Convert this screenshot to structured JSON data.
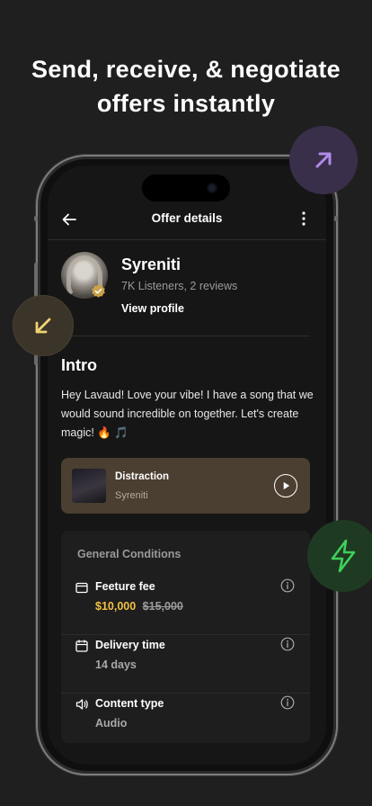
{
  "headline": {
    "line1": "Send, receive, & negotiate",
    "line2": "offers instantly"
  },
  "nav": {
    "title": "Offer details",
    "back_icon": "arrow-left-icon",
    "more_icon": "more-vertical-icon"
  },
  "profile": {
    "name": "Syreniti",
    "stats": "7K Listeners, 2 reviews",
    "view_profile": "View profile",
    "verified_icon": "verified-badge-icon"
  },
  "intro": {
    "title": "Intro",
    "text": "Hey Lavaud! Love your vibe! I have a song that we would sound incredible on together. Let's create magic! 🔥 🎵"
  },
  "track": {
    "title": "Distraction",
    "artist": "Syreniti",
    "play_icon": "play-icon"
  },
  "conditions": {
    "heading": "General Conditions",
    "rows": [
      {
        "icon": "wallet-icon",
        "label": "Feeture fee",
        "price_new": "$10,000",
        "price_old": "$15,000"
      },
      {
        "icon": "calendar-icon",
        "label": "Delivery time",
        "value": "14 days"
      },
      {
        "icon": "speaker-icon",
        "label": "Content type",
        "value": "Audio"
      }
    ]
  },
  "decor": {
    "purple_bubble_icon": "arrow-up-right-icon",
    "brown_bubble_icon": "arrow-down-left-icon",
    "green_bubble_icon": "lightning-icon",
    "colors": {
      "gold": "#f0c040",
      "purple": "#b18be8",
      "green": "#3fd05a",
      "yellow": "#f2d272"
    }
  }
}
